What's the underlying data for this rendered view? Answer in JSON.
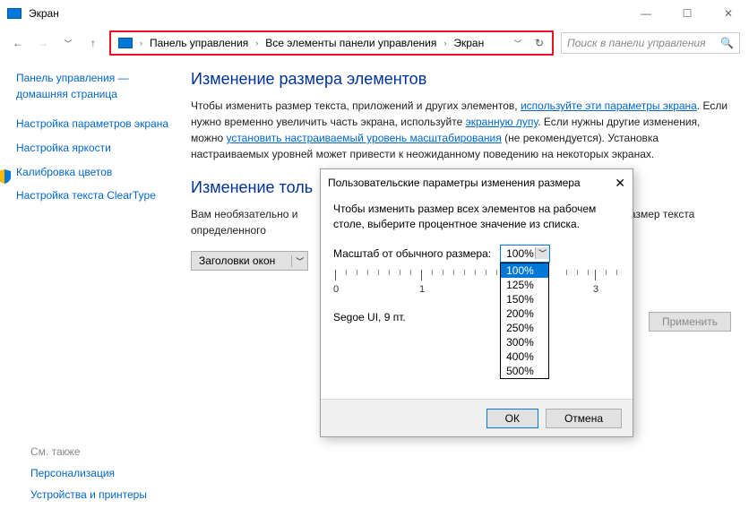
{
  "window": {
    "title": "Экран"
  },
  "breadcrumb": {
    "items": [
      "Панель управления",
      "Все элементы панели управления",
      "Экран"
    ]
  },
  "search": {
    "placeholder": "Поиск в панели управления"
  },
  "sidebar": {
    "home": "Панель управления —\nдомашняя страница",
    "links": [
      "Настройка параметров экрана",
      "Настройка яркости",
      "Калибровка цветов",
      "Настройка текста ClearType"
    ]
  },
  "main": {
    "h1": "Изменение размера элементов",
    "p1_a": "Чтобы изменить размер текста, приложений и других элементов, ",
    "p1_link1": "используйте эти параметры экрана",
    "p1_b": ". Если нужно временно увеличить часть экрана, используйте ",
    "p1_link2": "экранную лупу",
    "p1_c": ". Если нужны другие изменения, можно ",
    "p1_link3": "установить настраиваемый уровень масштабирования",
    "p1_d": " (не рекомендуется). Установка настраиваемых уровней может привести к неожиданному поведению на некоторых экранах.",
    "h2": "Изменение толь",
    "p2_a": "Вам необязательно и",
    "p2_b": "только размер текста определенного",
    "combo_label": "Заголовки окон",
    "apply": "Применить"
  },
  "dialog": {
    "title": "Пользовательские параметры изменения размера",
    "desc": "Чтобы изменить размер всех элементов на рабочем столе, выберите процентное значение из списка.",
    "scale_label": "Масштаб от обычного размера:",
    "scale_value": "100%",
    "options": [
      "100%",
      "125%",
      "150%",
      "200%",
      "250%",
      "300%",
      "400%",
      "500%"
    ],
    "ruler_labels": [
      "0",
      "1",
      "3"
    ],
    "font_info": "Segoe UI, 9 пт.",
    "ok": "ОК",
    "cancel": "Отмена"
  },
  "seealso": {
    "header": "См. также",
    "links": [
      "Персонализация",
      "Устройства и принтеры"
    ]
  }
}
